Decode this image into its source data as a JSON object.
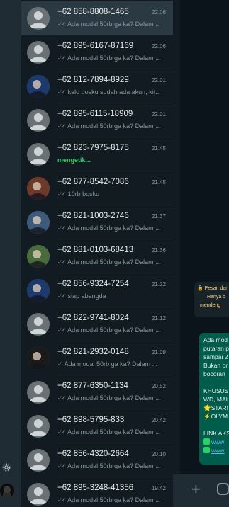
{
  "rail": {
    "settings_icon": "gear-icon",
    "profile_icon": "avatar"
  },
  "chats": [
    {
      "name": "+62 858-8808-1465",
      "time": "22.06",
      "ticks": "✓✓",
      "message": "Ada modal 50rb ga ka? Dalam ...",
      "avatar": "default",
      "selected": true
    },
    {
      "name": "+62 895-6167-87169",
      "time": "22.06",
      "ticks": "✓✓",
      "message": "Ada modal 50rb ga ka? Dalam ...",
      "avatar": "default"
    },
    {
      "name": "+62 812-7894-8929",
      "time": "22.01",
      "ticks": "✓✓",
      "message": "kalo bosku sudah ada akun, kit...",
      "avatar": "photo"
    },
    {
      "name": "+62 895-6115-18909",
      "time": "22.01",
      "ticks": "✓✓",
      "message": "Ada modal 50rb ga ka? Dalam ...",
      "avatar": "default"
    },
    {
      "name": "+62 823-7975-8175",
      "time": "21.45",
      "ticks": "",
      "message": "mengetik...",
      "avatar": "default",
      "typing": true
    },
    {
      "name": "+62 877-8542-7086",
      "time": "21.45",
      "ticks": "✓✓",
      "message": "10rb bosku",
      "avatar": "photo"
    },
    {
      "name": "+62 821-1003-2746",
      "time": "21.37",
      "ticks": "✓✓",
      "message": "Ada modal 50rb ga ka? Dalam ...",
      "avatar": "photo"
    },
    {
      "name": "+62 881-0103-68413",
      "time": "21.36",
      "ticks": "✓✓",
      "message": "Ada modal 50rb ga ka? Dalam ...",
      "avatar": "photo"
    },
    {
      "name": "+62 856-9324-7254",
      "time": "21.22",
      "ticks": "✓✓",
      "message": "siap abangda",
      "avatar": "photo"
    },
    {
      "name": "+62 822-9741-8024",
      "time": "21.12",
      "ticks": "✓✓",
      "message": "Ada modal 50rb ga ka? Dalam ...",
      "avatar": "default"
    },
    {
      "name": "+62 821-2932-0148",
      "time": "21.09",
      "ticks": "✓",
      "message": "Ada modal 50rb ga ka? Dalam ...",
      "avatar": "photo"
    },
    {
      "name": "+62 877-6350-1134",
      "time": "20.52",
      "ticks": "✓✓",
      "message": "Ada modal 50rb ga ka? Dalam ...",
      "avatar": "default"
    },
    {
      "name": "+62 898-5795-833",
      "time": "20.42",
      "ticks": "✓✓",
      "message": "Ada modal 50rb ga ka? Dalam ...",
      "avatar": "default"
    },
    {
      "name": "+62 856-4320-2664",
      "time": "20.10",
      "ticks": "✓✓",
      "message": "Ada modal 50rb ga ka? Dalam ...",
      "avatar": "default"
    },
    {
      "name": "+62 895-3248-41356",
      "time": "19.42",
      "ticks": "✓✓",
      "message": "Ada modal 50rb ga ka? Dalam ...",
      "avatar": "default"
    }
  ],
  "encryption": {
    "line1": "🔒 Pesan dar",
    "line2": "Hanya c",
    "line3": "mendeng"
  },
  "bubble": {
    "lines": [
      "Ada mod",
      "putaran p",
      "sampai 2",
      "Bukan or",
      "bocoran",
      "",
      "KHUSUS",
      "WD, MAI",
      "🌟STARI",
      "⚡OLYM",
      "",
      "LINK AKS"
    ],
    "links": [
      "www",
      "www"
    ]
  },
  "composer": {
    "attach_icon": "plus-icon",
    "sticker_icon": "sticker-icon"
  },
  "colors": {
    "panel": "#202c33",
    "list": "#111b21",
    "accent": "#25d366",
    "bubble": "#005c4b"
  }
}
